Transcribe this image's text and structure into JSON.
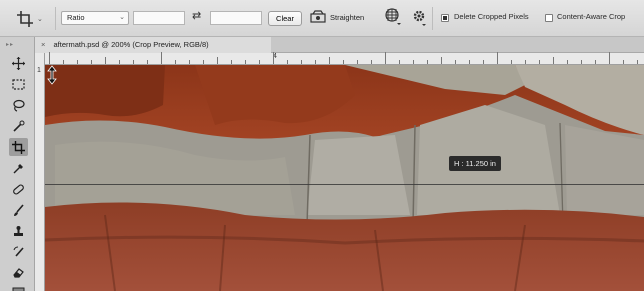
{
  "options_bar": {
    "aspect_dropdown": "Ratio",
    "clear_button": "Clear",
    "straighten_label": "Straighten",
    "delete_cropped_label": "Delete Cropped Pixels",
    "delete_cropped_checked": true,
    "content_aware_label": "Content-Aware Crop",
    "content_aware_checked": false
  },
  "document": {
    "tab_title": "aftermath.psd @ 200% (Crop Preview, RGB/8)",
    "close_glyph": "×"
  },
  "ruler": {
    "top_number": "4",
    "left_number": "1"
  },
  "canvas": {
    "measure_tooltip": "H : 11.250 in"
  },
  "toolbar_tools": [
    "move-tool-icon",
    "marquee-tool-icon",
    "lasso-tool-icon",
    "quick-select-tool-icon",
    "crop-tool-icon",
    "eyedropper-tool-icon",
    "healing-brush-tool-icon",
    "brush-tool-icon",
    "clone-stamp-tool-icon",
    "history-brush-tool-icon",
    "eraser-tool-icon",
    "gradient-tool-icon"
  ],
  "colors": {
    "brick_red": "#9a3a1f",
    "mortar_gray": "#9c9a92",
    "toolbar_bg": "#cecece"
  }
}
